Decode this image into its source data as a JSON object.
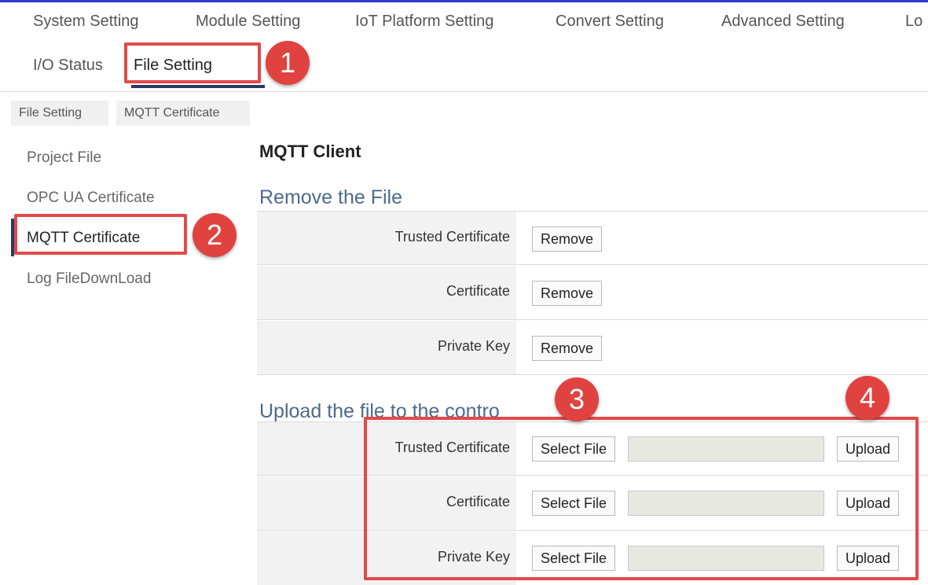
{
  "top_menu": [
    "System Setting",
    "Module Setting",
    "IoT Platform Setting",
    "Convert Setting",
    "Advanced Setting",
    "Lo"
  ],
  "tabs": {
    "io_status": "I/O Status",
    "file_setting": "File Setting"
  },
  "subtabs": [
    "File Setting",
    "MQTT Certificate"
  ],
  "sidebar": [
    "Project File",
    "OPC UA Certificate",
    "MQTT Certificate",
    "Log FileDownLoad"
  ],
  "content": {
    "title": "MQTT Client",
    "remove_heading": "Remove the File",
    "upload_heading": "Upload the file to the contro",
    "remove_rows": [
      {
        "label": "Trusted Certificate",
        "button": "Remove"
      },
      {
        "label": "Certificate",
        "button": "Remove"
      },
      {
        "label": "Private Key",
        "button": "Remove"
      }
    ],
    "upload_rows": [
      {
        "label": "Trusted Certificate",
        "select": "Select File",
        "upload": "Upload"
      },
      {
        "label": "Certificate",
        "select": "Select File",
        "upload": "Upload"
      },
      {
        "label": "Private Key",
        "select": "Select File",
        "upload": "Upload"
      }
    ]
  },
  "annotations": [
    "1",
    "2",
    "3",
    "4"
  ],
  "colors": {
    "annotation_red": "#e24a4a",
    "accent_navy": "#2b3a63",
    "heading_blue": "#4d6a8c"
  }
}
